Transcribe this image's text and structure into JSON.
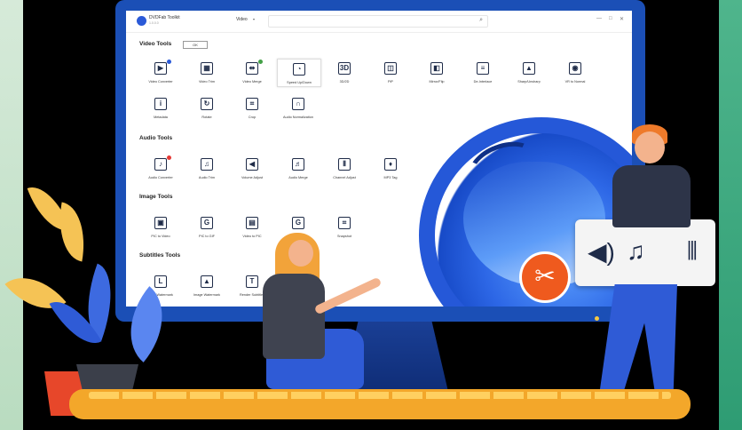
{
  "app": {
    "name": "DVDFab Toolkit",
    "version": "1.0.0.0",
    "category_select": "Video",
    "search_placeholder": ""
  },
  "window_controls": [
    "—",
    "□",
    "✕"
  ],
  "ok_button": "OK",
  "sections": [
    {
      "title": "Video Tools",
      "tools": [
        {
          "label": "Video Converter",
          "icon": "video-converter-icon",
          "glyph": "▶"
        },
        {
          "label": "Video Trim",
          "icon": "film-trim-icon",
          "glyph": "▦"
        },
        {
          "label": "Video Merge",
          "icon": "merge-icon",
          "glyph": "⇹"
        },
        {
          "label": "Speed Up/Down",
          "icon": "speed-icon",
          "glyph": "◔"
        },
        {
          "label": "3D/2D",
          "icon": "3d-icon",
          "glyph": "3D"
        },
        {
          "label": "PiP",
          "icon": "pip-icon",
          "glyph": "◫"
        },
        {
          "label": "Mirror/Flip",
          "icon": "mirror-icon",
          "glyph": "◧"
        },
        {
          "label": "De-Interlace",
          "icon": "deinterlace-icon",
          "glyph": "≡"
        },
        {
          "label": "Sharp/Unsharp",
          "icon": "sharp-icon",
          "glyph": "▲"
        },
        {
          "label": "VR to Normal",
          "icon": "vr-icon",
          "glyph": "◉"
        },
        {
          "label": "Metadata",
          "icon": "metadata-icon",
          "glyph": "i"
        },
        {
          "label": "Rotate",
          "icon": "rotate-icon",
          "glyph": "↻"
        },
        {
          "label": "Crop",
          "icon": "crop-icon",
          "glyph": "⌗"
        },
        {
          "label": "Audio Normalization",
          "icon": "headphones-icon",
          "glyph": "∩"
        }
      ]
    },
    {
      "title": "Audio Tools",
      "tools": [
        {
          "label": "Audio Converter",
          "icon": "audio-converter-icon",
          "glyph": "♪"
        },
        {
          "label": "Audio Trim",
          "icon": "audio-trim-icon",
          "glyph": "♫"
        },
        {
          "label": "Volume Adjust",
          "icon": "volume-icon",
          "glyph": "◀"
        },
        {
          "label": "Audio Merge",
          "icon": "audio-merge-icon",
          "glyph": "♬"
        },
        {
          "label": "Channel Adjust",
          "icon": "channel-icon",
          "glyph": "⫴"
        },
        {
          "label": "MP3 Tag",
          "icon": "tag-icon",
          "glyph": "♦"
        }
      ]
    },
    {
      "title": "Image Tools",
      "tools": [
        {
          "label": "PIC to Video",
          "icon": "pic-to-video-icon",
          "glyph": "▣"
        },
        {
          "label": "PIC to GIF",
          "icon": "gif-icon",
          "glyph": "G"
        },
        {
          "label": "Video to PIC",
          "icon": "video-to-pic-icon",
          "glyph": "▤"
        },
        {
          "label": "Vi",
          "icon": "video-to-gif-icon",
          "glyph": "G"
        },
        {
          "label": "Snapshot",
          "icon": "snapshot-icon",
          "glyph": "⌗"
        }
      ]
    },
    {
      "title": "Subtitles Tools",
      "tools": [
        {
          "label": "Time Watermark",
          "icon": "time-watermark-icon",
          "glyph": "L"
        },
        {
          "label": "Image Watermark",
          "icon": "image-watermark-icon",
          "glyph": "▲"
        },
        {
          "label": "Render Subtitles",
          "icon": "text-icon",
          "glyph": "T"
        }
      ]
    }
  ],
  "panel_icons": [
    "volume-icon",
    "audio-merge-icon",
    "channel-adjust-icon"
  ],
  "colors": {
    "accent": "#2b5ad8",
    "badge_red": "#e53935",
    "badge_green": "#43a047",
    "orange": "#ef5a1e"
  }
}
